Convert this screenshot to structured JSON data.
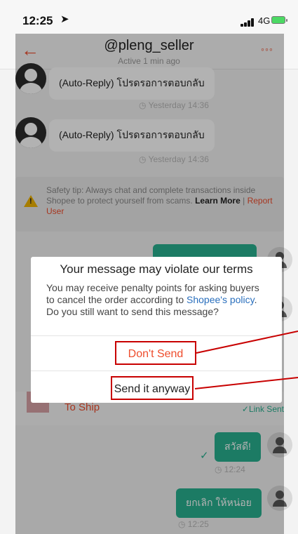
{
  "status_bar": {
    "time": "12:25",
    "location_icon": "➤",
    "network": "4G"
  },
  "header": {
    "title": "@pleng_seller",
    "subtitle": "Active 1 min ago"
  },
  "messages": {
    "auto_reply_1": {
      "text": "(Auto-Reply) โปรดรอการตอบกลับ",
      "time": "◷ Yesterday 14:36"
    },
    "auto_reply_2": {
      "text": "(Auto-Reply) โปรดรอการตอบกลับ",
      "time": "◷ Yesterday 14:36"
    }
  },
  "safety_tip": {
    "text": "Safety tip: Always chat and complete transactions inside Shopee to protect yourself from scams. ",
    "learn_more": "Learn More",
    "separator": " | ",
    "report": "Report User"
  },
  "order": {
    "status": "To Ship",
    "link_sent": "✓Link Sent"
  },
  "user_messages": {
    "msg1": {
      "text": "สวัสดี!",
      "time": "◷ 12:24"
    },
    "msg2": {
      "text": "ยกเลิก ให้หน่อย",
      "time": "◷ 12:25"
    }
  },
  "dialog": {
    "title": "Your message may violate our terms",
    "body_1": "You may receive penalty points for asking buyers to cancel the order according to ",
    "policy_link": "Shopee's policy",
    "body_2": ". Do you still want to send this message?",
    "dont_send": "Don't Send",
    "send_anyway": "Send it anyway"
  },
  "colors": {
    "brand": "#ee4d2d",
    "accent_green": "#29b090",
    "annotation_red": "#c80000"
  },
  "icons": [
    "back-arrow-icon",
    "more-dots-icon",
    "warning-icon",
    "avatar-icon",
    "clock-icon",
    "check-icon",
    "location-arrow-icon",
    "signal-icon",
    "battery-icon"
  ]
}
